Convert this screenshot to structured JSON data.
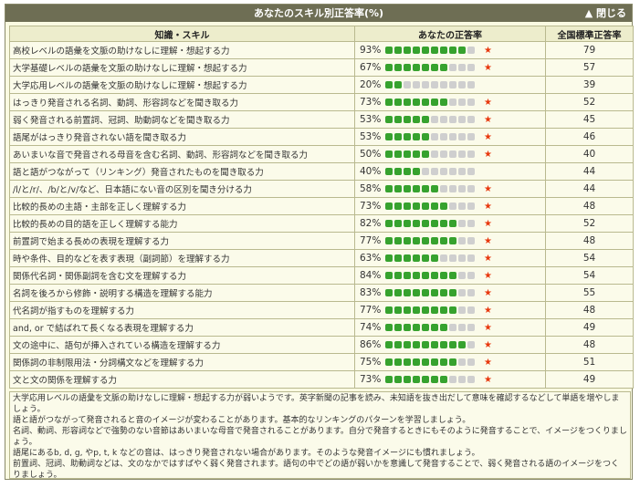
{
  "header": {
    "title": "あなたのスキル別正答率(%)",
    "close_label": "▲ 閉じる"
  },
  "table": {
    "columns": [
      "知識・スキル",
      "あなたの正答率",
      "全国標準正答率"
    ],
    "segments_total": 10,
    "rows": [
      {
        "skill": "高校レベルの語彙を文脈の助けなしに理解・想起する力",
        "pct": "93%",
        "filled": 9,
        "star": "★",
        "national": "79"
      },
      {
        "skill": "大学基礎レベルの語彙を文脈の助けなしに理解・想起する力",
        "pct": "67%",
        "filled": 7,
        "star": "★",
        "national": "57"
      },
      {
        "skill": "大学応用レベルの語彙を文脈の助けなしに理解・想起する力",
        "pct": "20%",
        "filled": 2,
        "star": "",
        "national": "39"
      },
      {
        "skill": "はっきり発音される名詞、動詞、形容詞などを聞き取る力",
        "pct": "73%",
        "filled": 7,
        "star": "★",
        "national": "52"
      },
      {
        "skill": "弱く発音される前置詞、冠詞、助動詞などを聞き取る力",
        "pct": "53%",
        "filled": 5,
        "star": "★",
        "national": "45"
      },
      {
        "skill": "語尾がはっきり発音されない語を聞き取る力",
        "pct": "53%",
        "filled": 5,
        "star": "★",
        "national": "46"
      },
      {
        "skill": "あいまいな音で発音される母音を含む名詞、動詞、形容詞などを聞き取る力",
        "pct": "50%",
        "filled": 5,
        "star": "★",
        "national": "40"
      },
      {
        "skill": "語と語がつながって（リンキング）発音されたものを聞き取る力",
        "pct": "40%",
        "filled": 4,
        "star": "",
        "national": "44"
      },
      {
        "skill": "/l/と/r/、/b/と/v/など、日本語にない音の区別を聞き分ける力",
        "pct": "58%",
        "filled": 6,
        "star": "★",
        "national": "44"
      },
      {
        "skill": "比較的長めの主語・主部を正しく理解する力",
        "pct": "73%",
        "filled": 7,
        "star": "★",
        "national": "48"
      },
      {
        "skill": "比較的長めの目的語を正しく理解する能力",
        "pct": "82%",
        "filled": 8,
        "star": "★",
        "national": "52"
      },
      {
        "skill": "前置詞で始まる長めの表現を理解する力",
        "pct": "77%",
        "filled": 8,
        "star": "★",
        "national": "48"
      },
      {
        "skill": "時や条件、目的などを表す表現（副詞節）を理解する力",
        "pct": "63%",
        "filled": 6,
        "star": "★",
        "national": "54"
      },
      {
        "skill": "関係代名詞・関係副詞を含む文を理解する力",
        "pct": "84%",
        "filled": 8,
        "star": "★",
        "national": "54"
      },
      {
        "skill": "名詞を後ろから修飾・説明する構造を理解する能力",
        "pct": "83%",
        "filled": 8,
        "star": "★",
        "national": "55"
      },
      {
        "skill": "代名詞が指すものを理解する力",
        "pct": "77%",
        "filled": 8,
        "star": "★",
        "national": "48"
      },
      {
        "skill": "and, or で結ばれて長くなる表現を理解する力",
        "pct": "74%",
        "filled": 7,
        "star": "★",
        "national": "49"
      },
      {
        "skill": "文の途中に、語句が挿入されている構造を理解する力",
        "pct": "86%",
        "filled": 9,
        "star": "★",
        "national": "48"
      },
      {
        "skill": "関係詞の非制限用法・分詞構文などを理解する力",
        "pct": "75%",
        "filled": 8,
        "star": "★",
        "national": "51"
      },
      {
        "skill": "文と文の関係を理解する力",
        "pct": "73%",
        "filled": 7,
        "star": "★",
        "national": "49"
      }
    ]
  },
  "notes": [
    "大学応用レベルの語彙を文脈の助けなしに理解・想起する力が弱いようです。英字新聞の記事を読み、未知語を抜き出だして意味を確認するなどして単語を増やしましょう。",
    "語と語がつながって発音されると音のイメージが変わることがあります。基本的なリンキングのパターンを学習しましょう。",
    "名詞、動詞、形容詞などで強勢のない音節はあいまいな母音で発音されることがあります。自分で発音するときにもそのように発音することで、イメージをつくりましょう。",
    "語尾にあるb, d, g, やp, t, k などの音は、はっきり発音されない場合があります。そのような発音イメージにも慣れましょう。",
    "前置詞、冠詞、助動詞などは、文のなかではすばやく弱く発音されます。語句の中でどの語が弱いかを意識して発音することで、弱く発音される語のイメージをつくりましょう。"
  ],
  "colors": {
    "header_bg": "#6e6e54",
    "segment_filled": "#36a22e",
    "segment_empty": "#cfcfcf",
    "star": "#e8380e"
  }
}
